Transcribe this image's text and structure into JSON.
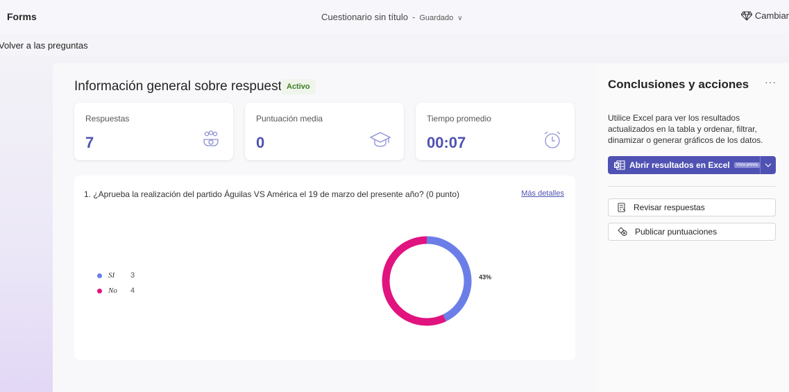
{
  "app": {
    "name": "Forms"
  },
  "header": {
    "form_title": "Cuestionario sin título",
    "separator": "-",
    "save_status": "Guardado",
    "upgrade_label": "Cambiar"
  },
  "nav": {
    "back_label": "Volver a las preguntas"
  },
  "overview": {
    "title": "Información general sobre respuestas",
    "status": "Activo",
    "stats": [
      {
        "label": "Respuestas",
        "value": "7",
        "icon": "people-icon"
      },
      {
        "label": "Puntuación media",
        "value": "0",
        "icon": "graduation-cap-icon"
      },
      {
        "label": "Tiempo promedio",
        "value": "00:07",
        "icon": "alarm-clock-icon"
      }
    ]
  },
  "question": {
    "title": "1. ¿Aprueba la realización del partido Águilas VS América el 19 de marzo del presente año? (0 punto)",
    "more_link": "Más detalles"
  },
  "chart_data": {
    "type": "pie",
    "categories": [
      "SI",
      "No"
    ],
    "values": [
      3,
      4
    ],
    "percent_labels": [
      "43%",
      "57%"
    ],
    "colors": [
      "#6b7ee8",
      "#e1137f"
    ],
    "legend": "left"
  },
  "side": {
    "title": "Conclusiones y acciones",
    "more": "···",
    "description": "Utilice Excel para ver los resultados actualizados en la tabla y ordenar, filtrar, dinamizar o generar gráficos de los datos.",
    "excel_button": "Abrir resultados en Excel",
    "excel_badge": "Vista previa",
    "actions": [
      {
        "label": "Revisar respuestas",
        "icon": "review-icon"
      },
      {
        "label": "Publicar puntuaciones",
        "icon": "publish-scores-icon"
      }
    ]
  },
  "colors": {
    "accent": "#4f52b2",
    "status_green": "#3a7d22"
  }
}
